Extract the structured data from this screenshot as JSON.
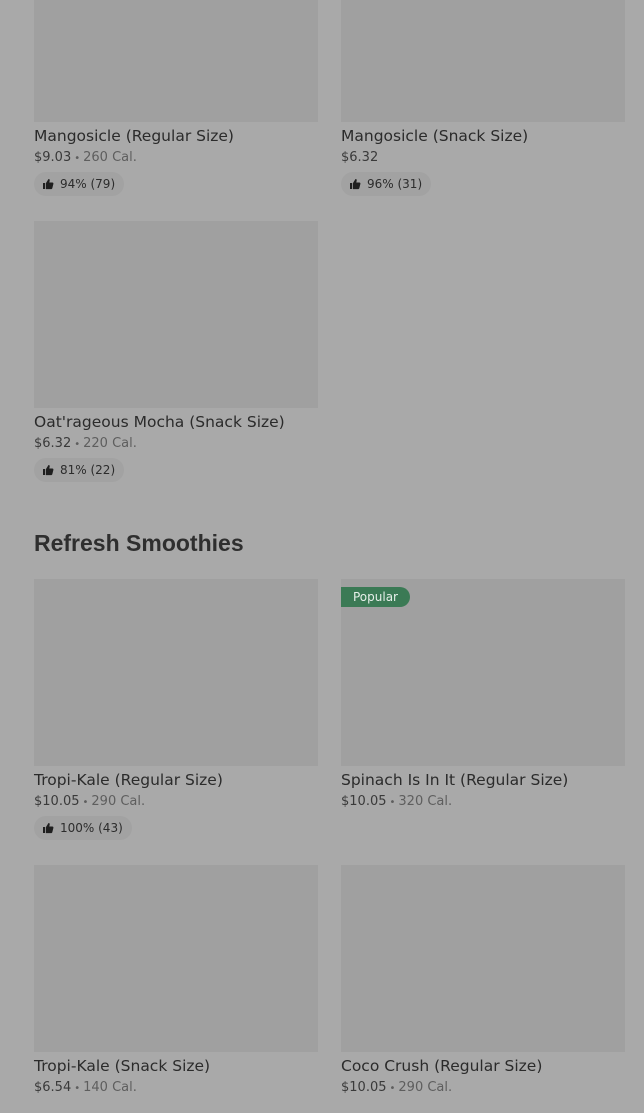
{
  "section": {
    "title": "Refresh Smoothies"
  },
  "items": [
    {
      "name": "Mangosicle (Regular Size)",
      "price": "$9.03",
      "calories": "260 Cal.",
      "rating": "94% (79)"
    },
    {
      "name": "Mangosicle (Snack Size)",
      "price": "$6.32",
      "rating": "96% (31)"
    },
    {
      "name": "Oat'rageous Mocha (Snack Size)",
      "price": "$6.32",
      "calories": "220 Cal.",
      "rating": "81% (22)"
    },
    {
      "name": "Tropi-Kale (Regular Size)",
      "price": "$10.05",
      "calories": "290 Cal.",
      "rating": "100% (43)"
    },
    {
      "name": "Spinach Is In It (Regular Size)",
      "price": "$10.05",
      "calories": "320 Cal.",
      "badge": "Popular"
    },
    {
      "name": "Tropi-Kale (Snack Size)",
      "price": "$6.54",
      "calories": "140 Cal."
    },
    {
      "name": "Coco Crush (Regular Size)",
      "price": "$10.05",
      "calories": "290 Cal."
    }
  ],
  "icons": {
    "rating": "thumbs-up-icon"
  },
  "colors": {
    "background": "#a9a9a9",
    "popular_badge": "#3b7a55"
  }
}
